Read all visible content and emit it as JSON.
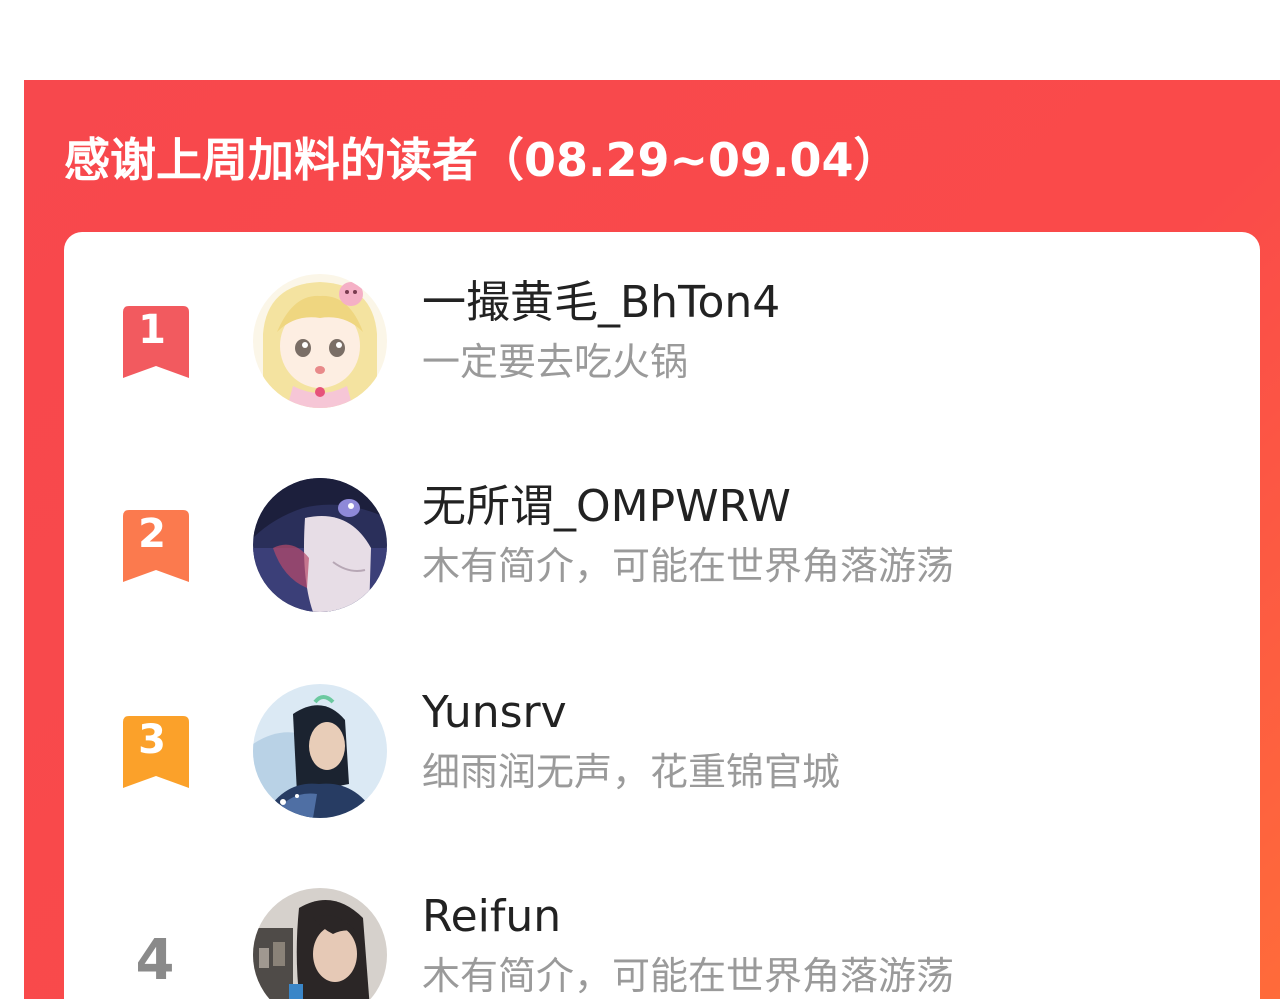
{
  "panel": {
    "title": "感谢上周加料的读者（08.29~09.04）"
  },
  "readers": [
    {
      "rank": "1",
      "name": "一撮黄毛_BhTon4",
      "bio": "一定要去吃火锅",
      "badge_color": "#f25a5f",
      "avatar_icon": "anime-blonde-girl-avatar"
    },
    {
      "rank": "2",
      "name": "无所谓_OMPWRW",
      "bio": "木有简介，可能在世界角落游荡",
      "badge_color": "#fb7a4e",
      "avatar_icon": "anime-boy-avatar"
    },
    {
      "rank": "3",
      "name": "Yunsrv",
      "bio": "细雨润无声，花重锦官城",
      "badge_color": "#fba12a",
      "avatar_icon": "fantasy-hero-avatar"
    },
    {
      "rank": "4",
      "name": "Reifun",
      "bio": "木有简介，可能在世界角落游荡",
      "badge_color": "",
      "avatar_icon": "photo-woman-avatar"
    }
  ]
}
